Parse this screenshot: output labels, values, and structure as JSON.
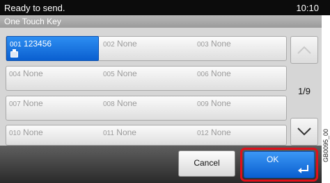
{
  "status": {
    "message": "Ready to send.",
    "time": "10:10"
  },
  "header": {
    "title": "One Touch Key"
  },
  "keys": [
    [
      {
        "num": "001",
        "name": "123456"
      },
      {
        "num": "002",
        "name": "None"
      },
      {
        "num": "003",
        "name": "None"
      }
    ],
    [
      {
        "num": "004",
        "name": "None"
      },
      {
        "num": "005",
        "name": "None"
      },
      {
        "num": "006",
        "name": "None"
      }
    ],
    [
      {
        "num": "007",
        "name": "None"
      },
      {
        "num": "008",
        "name": "None"
      },
      {
        "num": "009",
        "name": "None"
      }
    ],
    [
      {
        "num": "010",
        "name": "None"
      },
      {
        "num": "011",
        "name": "None"
      },
      {
        "num": "012",
        "name": "None"
      }
    ]
  ],
  "pagination": {
    "indicator": "1/9"
  },
  "actions": {
    "cancel": "Cancel",
    "ok": "OK"
  },
  "side_code": "GB0095_00",
  "icons": {
    "fax": "fax-icon",
    "up": "chevron-up-icon",
    "down": "chevron-down-icon",
    "enter": "enter-arrow-icon"
  },
  "colors": {
    "selected": "#0a5fd0",
    "highlight": "#e0101a"
  }
}
